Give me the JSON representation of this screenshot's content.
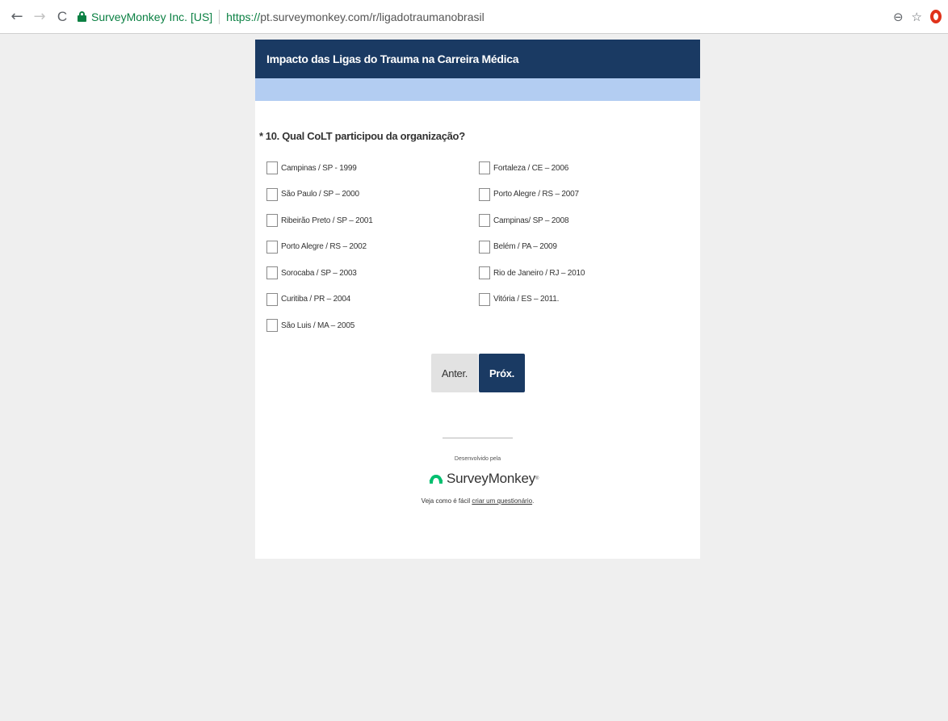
{
  "browser": {
    "back_icon": "←",
    "forward_icon": "→",
    "reload_icon": "C",
    "site_identity": "SurveyMonkey Inc. [US]",
    "url_scheme": "https://",
    "url_rest": "pt.surveymonkey.com/r/ligadotraumanobrasil",
    "zoom_icon": "⊖",
    "bookmark_icon": "☆"
  },
  "survey": {
    "title": "Impacto das Ligas do Trauma na Carreira Médica",
    "question": {
      "required_marker": "*",
      "text": "10. Qual CoLT participou da organização?"
    },
    "options_left": [
      {
        "label": "Campinas / SP - 1999",
        "checked": false
      },
      {
        "label": "São Paulo / SP – 2000",
        "checked": false
      },
      {
        "label": "Ribeirão Preto / SP – 2001",
        "checked": false
      },
      {
        "label": "Porto Alegre / RS – 2002",
        "checked": false
      },
      {
        "label": "Sorocaba / SP – 2003",
        "checked": false
      },
      {
        "label": "Curitiba / PR – 2004",
        "checked": false
      },
      {
        "label": "São Luis / MA – 2005",
        "checked": false
      }
    ],
    "options_right": [
      {
        "label": "Fortaleza / CE – 2006",
        "checked": false
      },
      {
        "label": "Porto Alegre / RS – 2007",
        "checked": false
      },
      {
        "label": "Campinas/ SP – 2008",
        "checked": false
      },
      {
        "label": "Belém / PA – 2009",
        "checked": false
      },
      {
        "label": "Rio de Janeiro / RJ – 2010",
        "checked": false
      },
      {
        "label": "Vitória / ES – 2011.",
        "checked": false
      }
    ],
    "buttons": {
      "prev_label": "Anter.",
      "next_label": "Próx."
    },
    "footer": {
      "powered_by": "Desenvolvido pela",
      "brand": "SurveyMonkey",
      "reg_mark": "®",
      "promo_prefix": "Veja como é fácil ",
      "promo_link": "criar um questionário",
      "promo_suffix": "."
    }
  },
  "colors": {
    "header_bg": "#1a3a63",
    "progress_bg": "#b3cdf2",
    "secure_green": "#0b8043",
    "brand_green": "#00bf6f"
  }
}
